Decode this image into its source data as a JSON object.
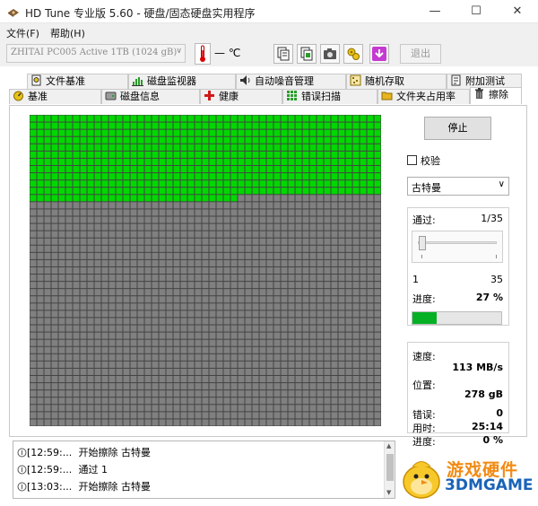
{
  "window": {
    "title": "HD Tune 专业版 5.60 - 硬盘/固态硬盘实用程序",
    "minimize_glyph": "—",
    "maximize_glyph": "☐",
    "close_glyph": "✕"
  },
  "menu": {
    "file": "文件(F)",
    "help": "帮助(H)"
  },
  "toolbar": {
    "drive": "ZHITAI PC005 Active 1TB (1024 gB)",
    "dropdown_glyph": "∨",
    "temperature": "— ℃",
    "exit": "退出",
    "icons": [
      "copy-icon",
      "copy-all-icon",
      "camera-icon",
      "settings-icon",
      "save-icon"
    ]
  },
  "tabs": {
    "row1": [
      {
        "label": "文件基准",
        "icon": "file-benchmark-icon"
      },
      {
        "label": "磁盘监视器",
        "icon": "disk-monitor-icon"
      },
      {
        "label": "自动噪音管理",
        "icon": "noise-icon"
      },
      {
        "label": "随机存取",
        "icon": "random-access-icon"
      },
      {
        "label": "附加测试",
        "icon": "extra-tests-icon"
      }
    ],
    "row2": [
      {
        "label": "基准",
        "icon": "benchmark-icon"
      },
      {
        "label": "磁盘信息",
        "icon": "disk-info-icon"
      },
      {
        "label": "健康",
        "icon": "health-icon"
      },
      {
        "label": "错误扫描",
        "icon": "error-scan-icon"
      },
      {
        "label": "文件夹占用率",
        "icon": "folder-icon"
      },
      {
        "label": "擦除",
        "icon": "erase-icon"
      }
    ],
    "active": "擦除"
  },
  "erase": {
    "grid": {
      "columns": 49,
      "rows": 43,
      "full_green_rows": 11,
      "split_row_green_columns": 29,
      "green_color": "#00d800",
      "gray_color": "#808080"
    },
    "stop": "停止",
    "verify_label": "校验",
    "verify_checked": false,
    "method": "古特曼",
    "dropdown_glyph": "∨",
    "pass_label": "通过:",
    "pass_value": "1/35",
    "slider_min": "1",
    "slider_max": "35",
    "slider_position": 1,
    "progress_label": "进度:",
    "progress_value": "27 %",
    "progress_fraction": 0.27,
    "speed_label": "速度:",
    "speed_value": "113 MB/s",
    "position_label": "位置:",
    "position_value": "278 gB",
    "errors_label": "错误:",
    "errors_value": "0",
    "elapsed_label": "用时:",
    "elapsed_value": "25:14",
    "overall_progress_label": "进度:",
    "overall_progress_value": "0 %"
  },
  "log": {
    "entries": [
      {
        "time": "[12:59:...",
        "message": "开始擦除 古特曼"
      },
      {
        "time": "[12:59:...",
        "message": "通过 1"
      },
      {
        "time": "[13:03:...",
        "message": "开始擦除 古特曼"
      }
    ],
    "scroll_up_glyph": "▲",
    "scroll_down_glyph": "▼"
  },
  "watermark": {
    "line1": "游戏硬件",
    "line2": "3DMGAME"
  }
}
